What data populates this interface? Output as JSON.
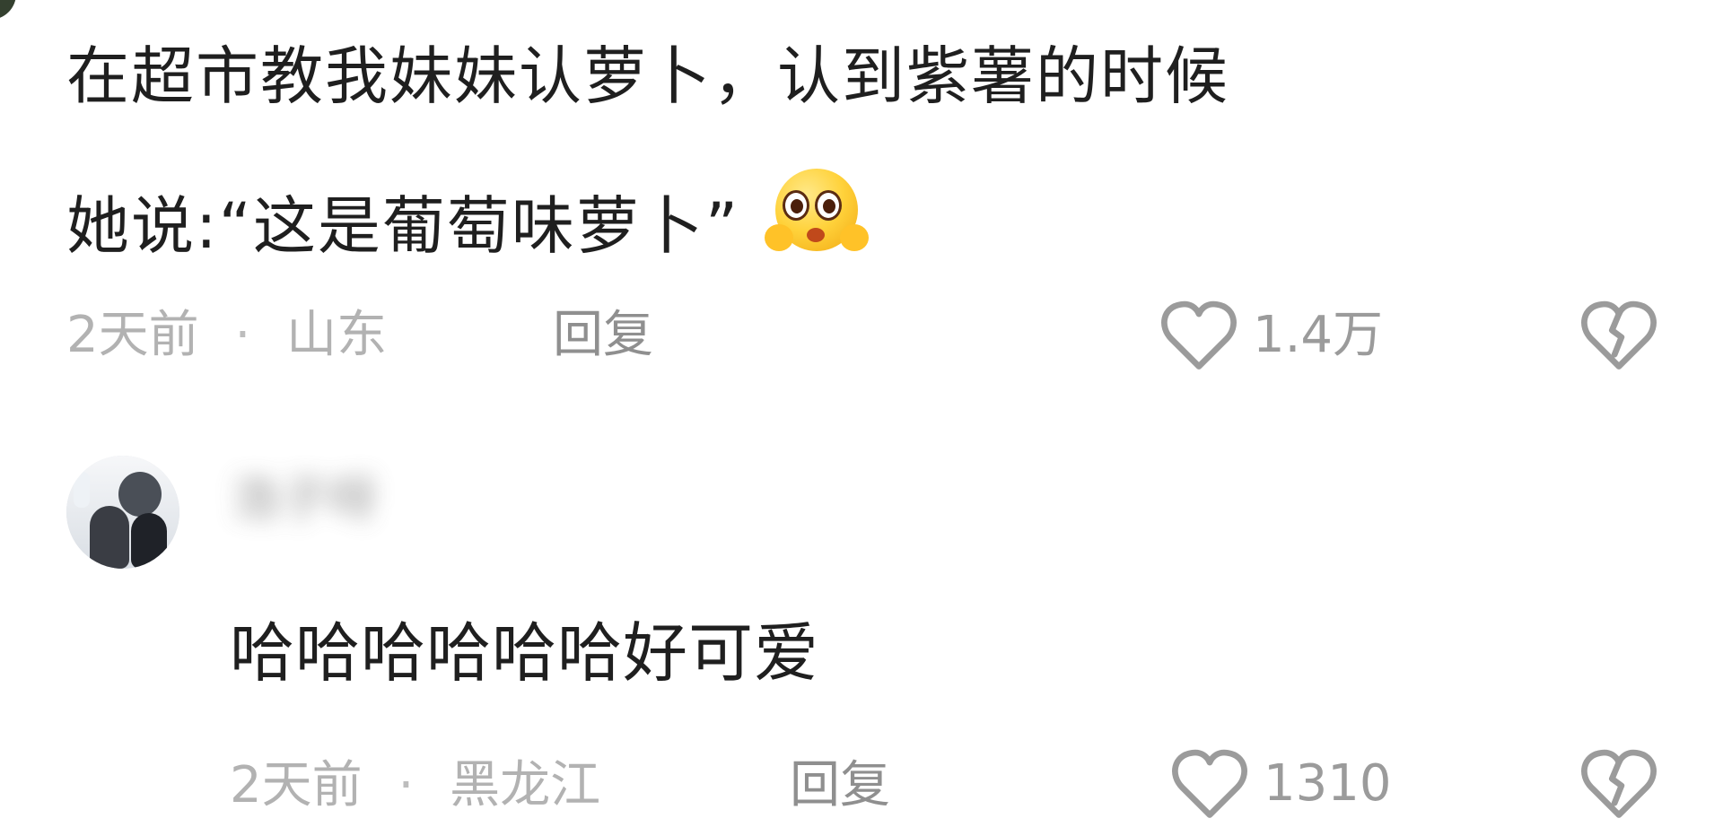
{
  "comment_main": {
    "text_line_1": "在超市教我妹妹认萝卜，认到紫薯的时候",
    "text_line_2": "她说:“这是葡萄味萝卜”",
    "emoji_icon": "pleading-face-icon",
    "meta": {
      "time": "2天前",
      "separator": "·",
      "location": "山东"
    },
    "reply_label": "回复",
    "like_count": "1.4万",
    "like_icon": "heart-outline-icon",
    "dislike_icon": "broken-heart-icon"
  },
  "comment_reply": {
    "username": "浩子呀",
    "text": "哈哈哈哈哈哈好可爱",
    "meta": {
      "time": "2天前",
      "separator": "·",
      "location": "黑龙江"
    },
    "reply_label": "回复",
    "like_count": "1310",
    "like_icon": "heart-outline-icon",
    "dislike_icon": "broken-heart-icon"
  },
  "colors": {
    "primary_text": "#1f1f1f",
    "meta_text": "#b2b2b2",
    "reply_text": "#8f8f8f",
    "icon": "#9b9b9b"
  }
}
